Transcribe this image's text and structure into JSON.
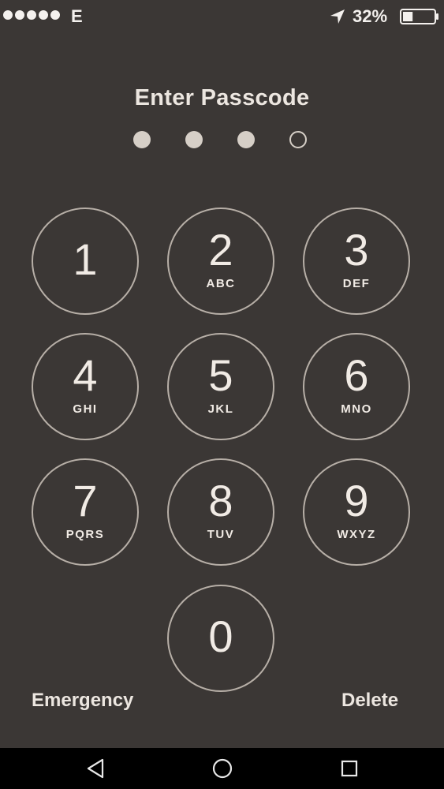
{
  "status_bar": {
    "carrier": "E",
    "battery_percent": "32%",
    "battery_level": 0.32,
    "signal_bars": 5,
    "icons": [
      "signal-dots",
      "location-arrow-icon",
      "battery-icon"
    ]
  },
  "lock_screen": {
    "title": "Enter Passcode",
    "passcode_length": 4,
    "digits_entered": 3
  },
  "keypad": {
    "keys": [
      {
        "digit": "1",
        "letters": ""
      },
      {
        "digit": "2",
        "letters": "ABC"
      },
      {
        "digit": "3",
        "letters": "DEF"
      },
      {
        "digit": "4",
        "letters": "GHI"
      },
      {
        "digit": "5",
        "letters": "JKL"
      },
      {
        "digit": "6",
        "letters": "MNO"
      },
      {
        "digit": "7",
        "letters": "PQRS"
      },
      {
        "digit": "8",
        "letters": "TUV"
      },
      {
        "digit": "9",
        "letters": "WXYZ"
      },
      {
        "digit": "0",
        "letters": ""
      }
    ]
  },
  "actions": {
    "emergency": "Emergency",
    "delete": "Delete"
  },
  "nav_bar": {
    "icons": [
      "back-icon",
      "home-icon",
      "recents-icon"
    ]
  },
  "colors": {
    "background": "#3b3735",
    "key_border": "#b7afa7",
    "text": "#ece6e0",
    "nav_bar": "#000000"
  }
}
